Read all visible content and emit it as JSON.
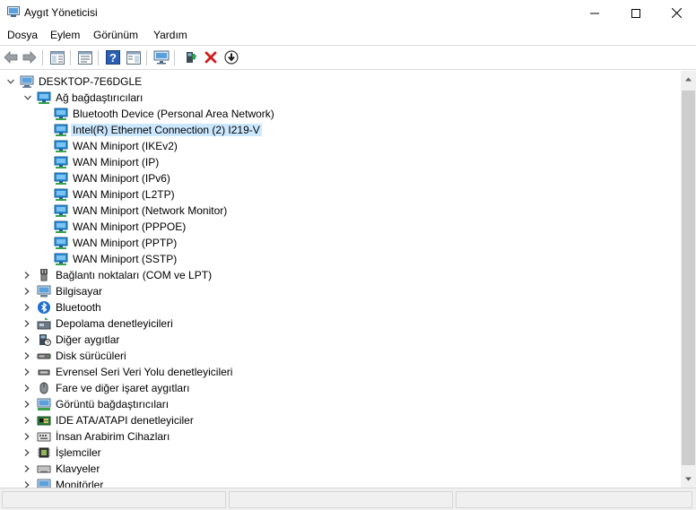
{
  "window": {
    "title": "Aygıt Yöneticisi"
  },
  "menu": [
    "Dosya",
    "Eylem",
    "Görünüm",
    "Yardım"
  ],
  "toolbar": {
    "buttons": [
      "back-icon",
      "forward-icon",
      "show-hide-tree-icon",
      "properties-icon",
      "help-icon",
      "action-pane-icon",
      "display-icon",
      "update-driver-icon",
      "uninstall-icon",
      "disable-device-icon"
    ]
  },
  "tree": {
    "root": "DESKTOP-7E6DGLE",
    "expanded_category": "Ağ bağdaştırıcıları",
    "network_adapters": [
      "Bluetooth Device (Personal Area Network)",
      "Intel(R) Ethernet Connection (2) I219-V",
      "WAN Miniport (IKEv2)",
      "WAN Miniport (IP)",
      "WAN Miniport (IPv6)",
      "WAN Miniport (L2TP)",
      "WAN Miniport (Network Monitor)",
      "WAN Miniport (PPPOE)",
      "WAN Miniport (PPTP)",
      "WAN Miniport (SSTP)"
    ],
    "selected_adapter": "Intel(R) Ethernet Connection (2) I219-V",
    "categories": [
      {
        "label": "Bağlantı noktaları (COM ve LPT)",
        "icon": "port-icon"
      },
      {
        "label": "Bilgisayar",
        "icon": "computer-icon"
      },
      {
        "label": "Bluetooth",
        "icon": "bluetooth-icon"
      },
      {
        "label": "Depolama denetleyicileri",
        "icon": "storage-controller-icon"
      },
      {
        "label": "Diğer aygıtlar",
        "icon": "unknown-device-icon"
      },
      {
        "label": "Disk sürücüleri",
        "icon": "disk-drive-icon"
      },
      {
        "label": "Evrensel Seri Veri Yolu denetleyicileri",
        "icon": "usb-icon"
      },
      {
        "label": "Fare ve diğer işaret aygıtları",
        "icon": "mouse-icon"
      },
      {
        "label": "Görüntü bağdaştırıcıları",
        "icon": "display-adapter-icon"
      },
      {
        "label": "IDE ATA/ATAPI denetleyiciler",
        "icon": "ide-controller-icon"
      },
      {
        "label": "İnsan Arabirim Cihazları",
        "icon": "hid-icon"
      },
      {
        "label": "İşlemciler",
        "icon": "processor-icon"
      },
      {
        "label": "Klavyeler",
        "icon": "keyboard-icon"
      },
      {
        "label": "Monitörler",
        "icon": "monitor-icon"
      }
    ]
  },
  "colors": {
    "selection": "#cce8ff",
    "network_icon": "#2a8fd6",
    "uninstall_red": "#d21e1e",
    "help_blue": "#2b5fb4"
  }
}
